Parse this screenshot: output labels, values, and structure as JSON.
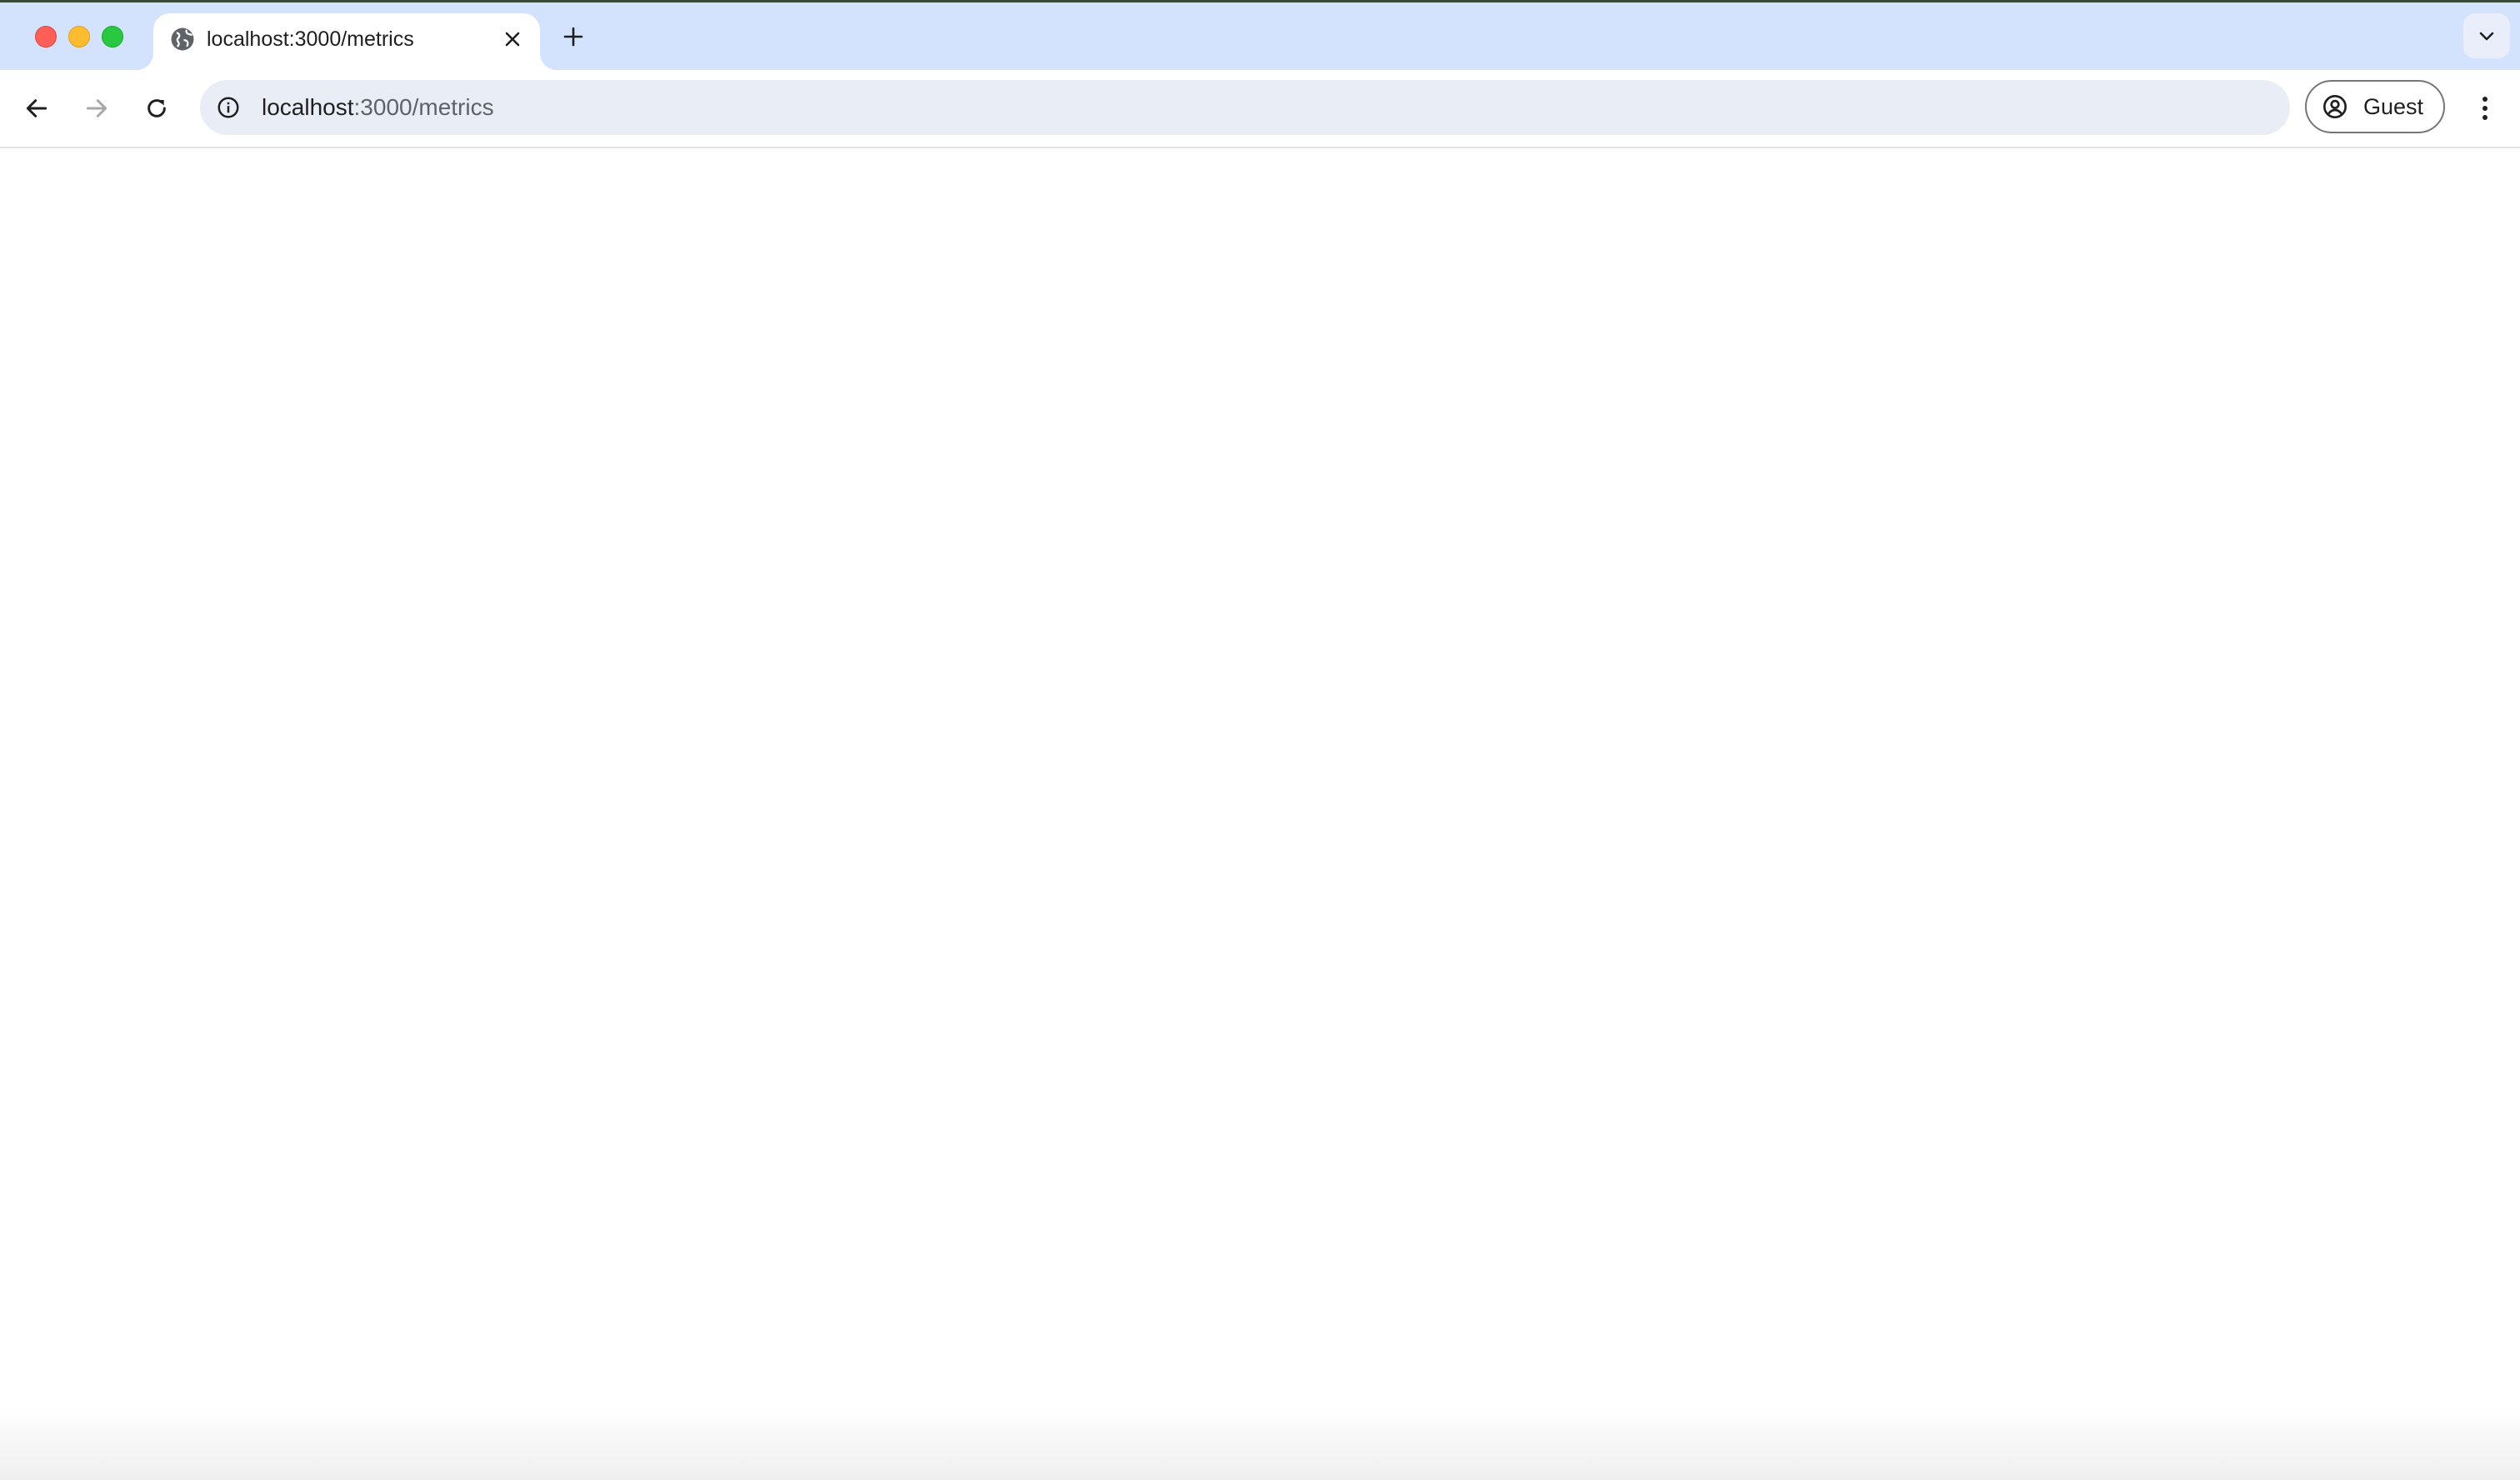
{
  "window": {
    "title": "localhost:3000/metrics"
  },
  "tabs": [
    {
      "title": "localhost:3000/metrics",
      "favicon": "globe-icon",
      "active": true
    }
  ],
  "toolbar": {
    "back_icon": "arrow-left-icon",
    "forward_icon": "arrow-right-icon",
    "reload_icon": "reload-icon",
    "forward_enabled": false
  },
  "omnibox": {
    "host": "localhost",
    "path": ":3000/metrics",
    "info_icon": "info-icon"
  },
  "profile": {
    "label": "Guest",
    "icon": "account-circle-icon"
  },
  "colors": {
    "tabstrip": "#d3e3fd",
    "omnibox": "#e9eef6",
    "close": "#ff5f57",
    "minimize": "#febc2e",
    "maximize": "#28c840"
  }
}
